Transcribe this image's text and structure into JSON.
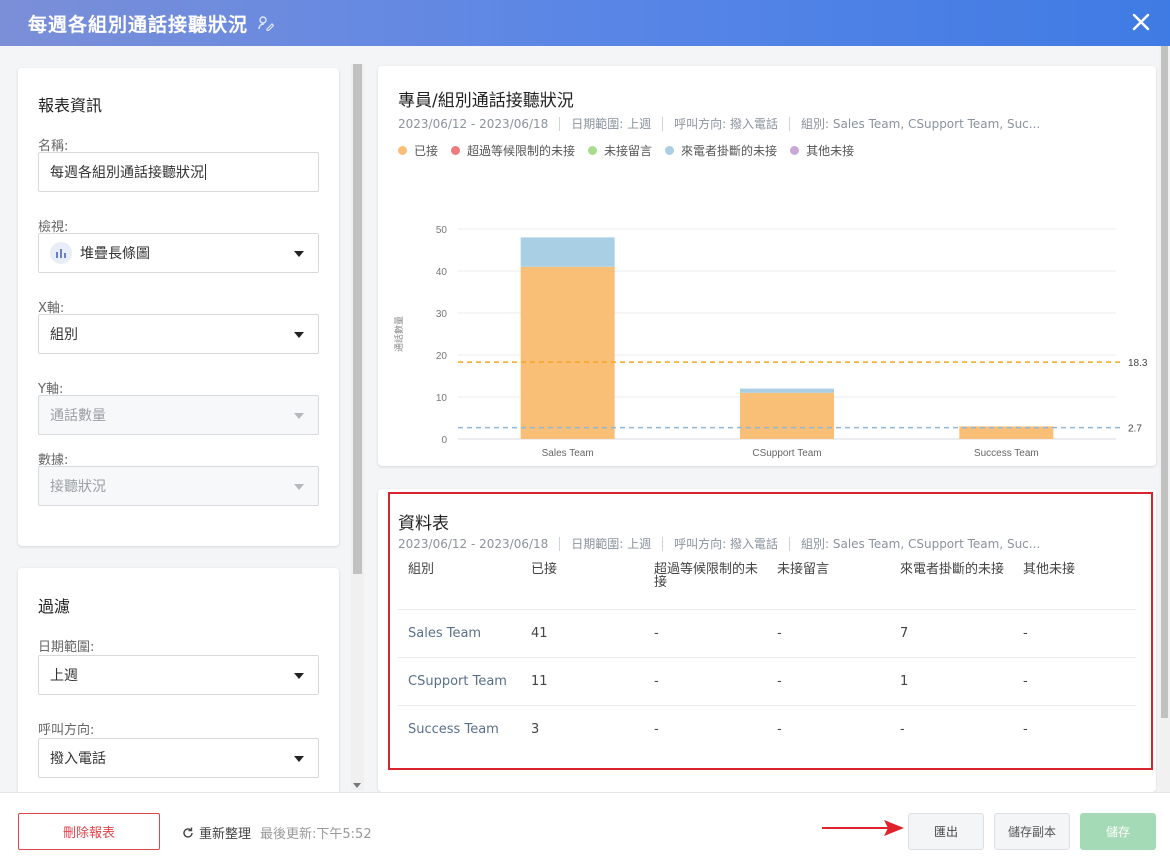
{
  "header": {
    "title": "每週各組別通話接聽狀況"
  },
  "report_info": {
    "title": "報表資訊",
    "name_label": "名稱:",
    "name_value": "每週各組別通話接聽狀況",
    "view_label": "檢視:",
    "view_value": "堆疊長條圖",
    "x_label": "X軸:",
    "x_value": "組別",
    "y_label": "Y軸:",
    "y_value": "通話數量",
    "data_label": "數據:",
    "data_value": "接聽狀況"
  },
  "filter": {
    "title": "過濾",
    "date_label": "日期範圍:",
    "date_value": "上週",
    "direction_label": "呼叫方向:",
    "direction_value": "撥入電話"
  },
  "chart_card": {
    "title": "專員/組別通話接聽狀況",
    "meta": {
      "dates": "2023/06/12 - 2023/06/18",
      "range": "日期範圍: 上週",
      "direction": "呼叫方向: 撥入電話",
      "groups": "組別: Sales Team, CSupport Team, Suc..."
    }
  },
  "chart_data": {
    "type": "bar",
    "stacked": true,
    "categories": [
      "Sales Team",
      "CSupport Team",
      "Success Team"
    ],
    "series": [
      {
        "name": "已接",
        "color": "#f9bf77",
        "values": [
          41,
          11,
          3
        ]
      },
      {
        "name": "超過等候限制的未接",
        "color": "#ee7b7f",
        "values": [
          0,
          0,
          0
        ]
      },
      {
        "name": "未接留言",
        "color": "#a9dc8f",
        "values": [
          0,
          0,
          0
        ]
      },
      {
        "name": "來電者掛斷的未接",
        "color": "#a8cfe3",
        "values": [
          7,
          1,
          0
        ]
      },
      {
        "name": "其他未接",
        "color": "#c9a9d8",
        "values": [
          0,
          0,
          0
        ]
      }
    ],
    "xlabel": "組別",
    "ylabel": "通話數量",
    "ylim": [
      0,
      50
    ],
    "yticks": [
      0,
      10,
      20,
      30,
      40,
      50
    ],
    "ref_lines": [
      {
        "value": 18.3,
        "label": "18.3",
        "color": "#f5a623"
      },
      {
        "value": 2.7,
        "label": "2.7",
        "color": "#8fb8d8"
      }
    ],
    "grid": true,
    "legend": "top-left"
  },
  "table_card": {
    "title": "資料表",
    "meta": {
      "dates": "2023/06/12 - 2023/06/18",
      "range": "日期範圍: 上週",
      "direction": "呼叫方向: 撥入電話",
      "groups": "組別: Sales Team, CSupport Team, Suc..."
    },
    "columns": [
      "組別",
      "已接",
      "超過等候限制的未接",
      "未接留言",
      "來電者掛斷的未接",
      "其他未接"
    ],
    "rows": [
      [
        "Sales Team",
        "41",
        "-",
        "-",
        "7",
        "-"
      ],
      [
        "CSupport Team",
        "11",
        "-",
        "-",
        "1",
        "-"
      ],
      [
        "Success Team",
        "3",
        "-",
        "-",
        "-",
        "-"
      ]
    ]
  },
  "footer": {
    "delete_label": "刪除報表",
    "refresh_label": "重新整理",
    "last_update": "最後更新:下午5:52",
    "export_label": "匯出",
    "copy_label": "儲存副本",
    "save_label": "儲存"
  }
}
